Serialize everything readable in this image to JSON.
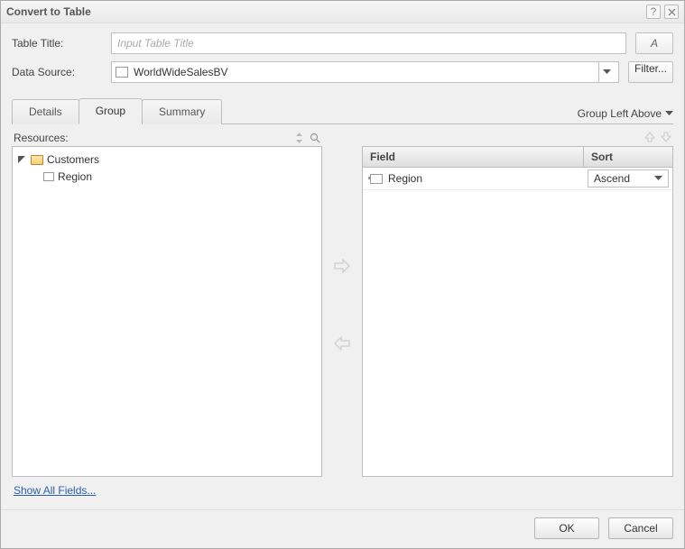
{
  "window": {
    "title": "Convert to Table"
  },
  "form": {
    "table_title_label": "Table Title:",
    "table_title_placeholder": "Input Table Title",
    "table_title_value": "",
    "data_source_label": "Data Source:",
    "data_source_value": "WorldWideSalesBV",
    "filter_label": "Filter...",
    "font_button_label": "Aᴢ"
  },
  "tabs": {
    "items": [
      {
        "label": "Details"
      },
      {
        "label": "Group"
      },
      {
        "label": "Summary"
      }
    ],
    "active_index": 1,
    "right_label": "Group Left Above"
  },
  "left": {
    "header": "Resources:",
    "root": {
      "label": "Customers"
    },
    "children": [
      {
        "label": "Region"
      }
    ]
  },
  "grid": {
    "col_field": "Field",
    "col_sort": "Sort",
    "rows": [
      {
        "field": "Region",
        "sort": "Ascend"
      }
    ]
  },
  "footer": {
    "show_all": "Show All Fields...",
    "ok": "OK",
    "cancel": "Cancel"
  }
}
